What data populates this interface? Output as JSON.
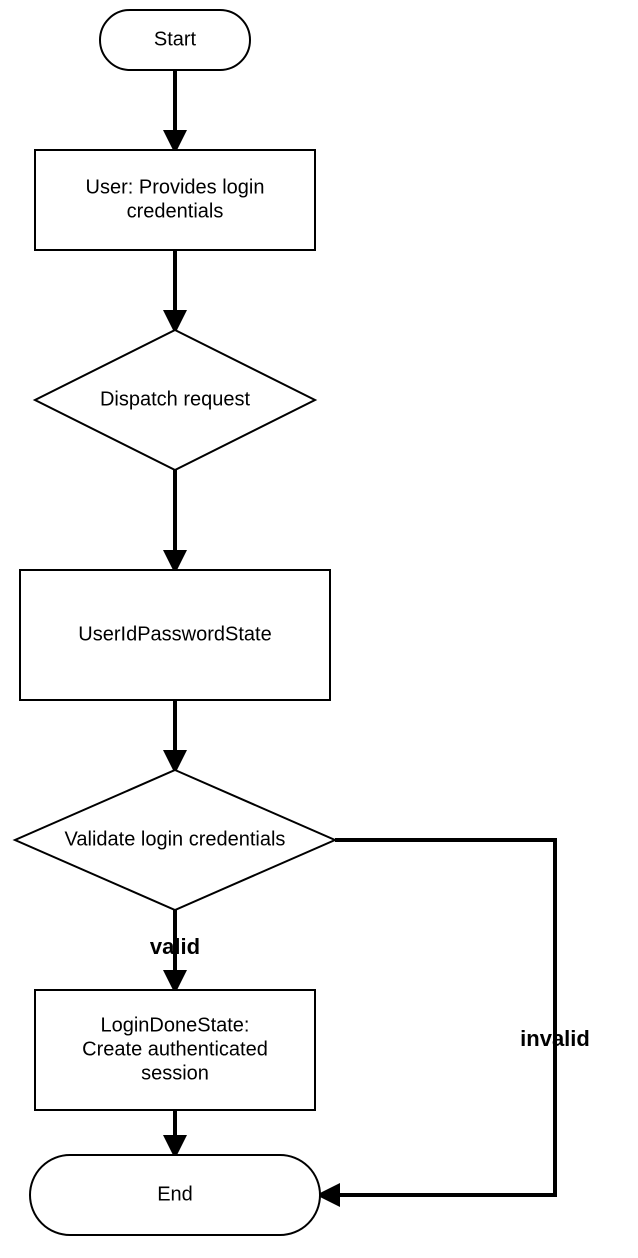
{
  "nodes": {
    "start": {
      "label": "Start"
    },
    "user_credentials": {
      "line1": "User: Provides login",
      "line2": "credentials"
    },
    "dispatch": {
      "label": "Dispatch request"
    },
    "userid_state": {
      "label": "UserIdPasswordState"
    },
    "validate": {
      "label": "Validate login credentials"
    },
    "login_done": {
      "line1": "LoginDoneState:",
      "line2": "Create authenticated",
      "line3": "session"
    },
    "end": {
      "label": "End"
    }
  },
  "edges": {
    "valid": "valid",
    "invalid": "invalid"
  }
}
